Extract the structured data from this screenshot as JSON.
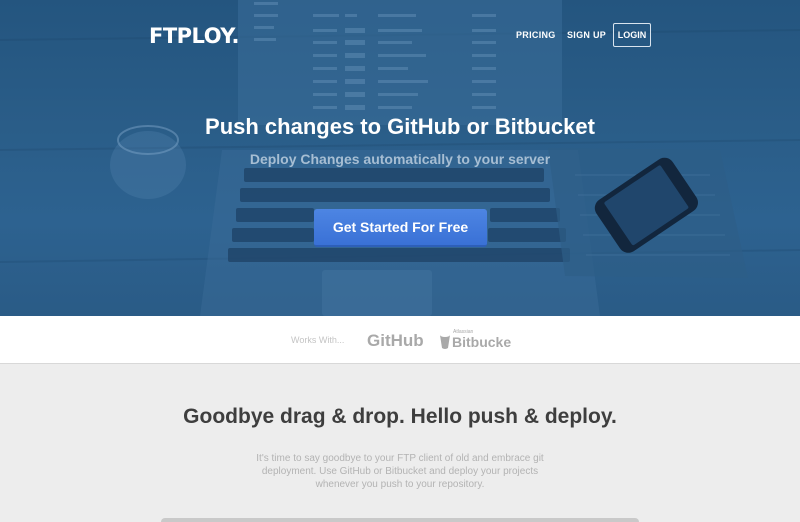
{
  "brand": {
    "logo_text": "FTPLOY."
  },
  "nav": {
    "pricing": "PRICING",
    "signup": "SIGN UP",
    "login": "LOGIN"
  },
  "hero": {
    "title": "Push changes to GitHub or Bitbucket",
    "subtitle": "Deploy Changes automatically to your server",
    "cta_label": "Get Started For Free"
  },
  "works_with": {
    "label": "Works With...",
    "logos": [
      "GitHub",
      "Atlassian",
      "Bitbucket"
    ]
  },
  "intro": {
    "title": "Goodbye drag & drop. Hello push & deploy.",
    "lines": [
      "It's time to say goodbye to your FTP client of old and embrace git",
      "deployment. Use GitHub or Bitbucket and deploy your projects",
      "whenever you push to your repository."
    ]
  },
  "colors": {
    "hero_overlay": "#2a5b86",
    "cta": "#3f76db",
    "page_bg": "#ededed"
  }
}
